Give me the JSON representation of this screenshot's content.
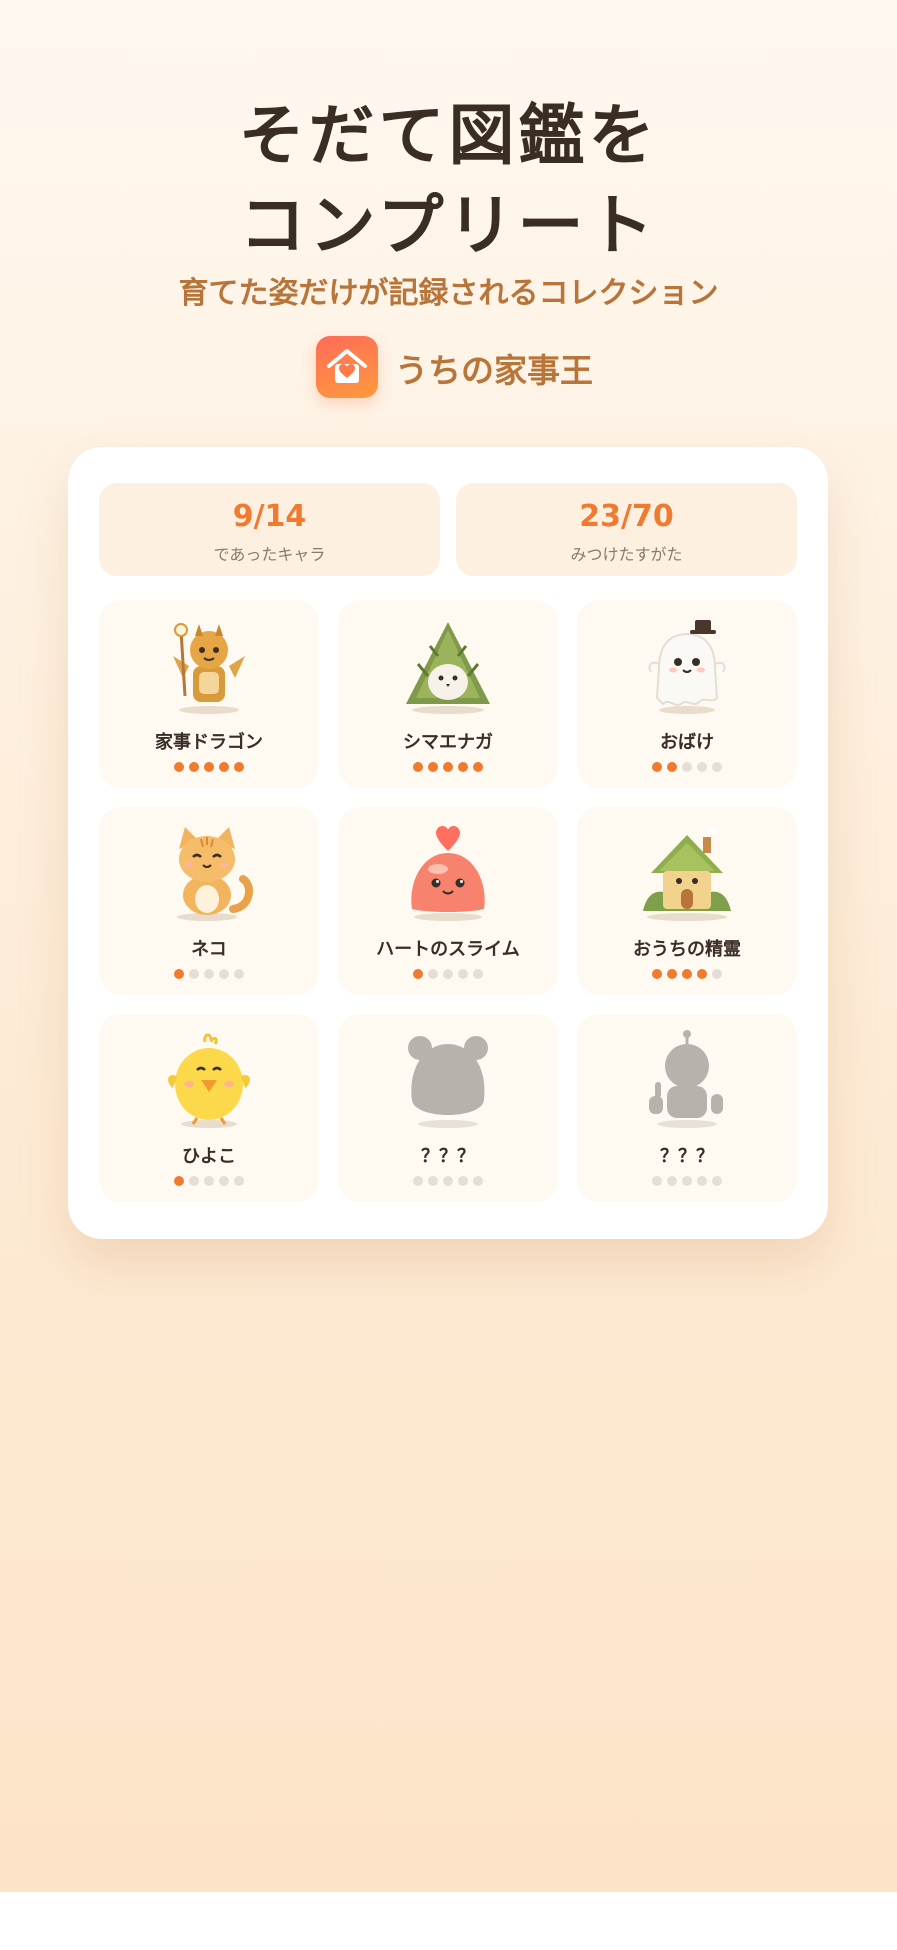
{
  "headline": {
    "line1": "そだて図鑑を",
    "line2": "コンプリート"
  },
  "subtitle": "育てた姿だけが記録されるコレクション",
  "brand": {
    "name": "うちの家事王",
    "icon": "house-heart-icon"
  },
  "stats": [
    {
      "value": "9/14",
      "label": "であったキャラ"
    },
    {
      "value": "23/70",
      "label": "みつけたすがた"
    }
  ],
  "characters": [
    {
      "name": "家事ドラゴン",
      "level": 5,
      "max_level": 5,
      "icon": "golden-dragon-knight"
    },
    {
      "name": "シマエナガ",
      "level": 5,
      "max_level": 5,
      "icon": "leafy-long-tailed-tit"
    },
    {
      "name": "おばけ",
      "level": 2,
      "max_level": 5,
      "icon": "ghost-with-top-hat"
    },
    {
      "name": "ネコ",
      "level": 1,
      "max_level": 5,
      "icon": "orange-tabby-cat"
    },
    {
      "name": "ハートのスライム",
      "level": 1,
      "max_level": 5,
      "icon": "pink-heart-slime"
    },
    {
      "name": "おうちの精霊",
      "level": 4,
      "max_level": 5,
      "icon": "leafy-house-spirit"
    },
    {
      "name": "ひよこ",
      "level": 1,
      "max_level": 5,
      "icon": "yellow-chick"
    },
    {
      "name": "？？？",
      "level": 0,
      "max_level": 5,
      "icon": "locked-hamster-silhouette"
    },
    {
      "name": "？？？",
      "level": 0,
      "max_level": 5,
      "icon": "locked-robot-silhouette"
    }
  ],
  "colors": {
    "accent": "#f07a30",
    "text": "#3a2e24",
    "brand": "#b8753a",
    "dot_off": "#e4ded6"
  }
}
